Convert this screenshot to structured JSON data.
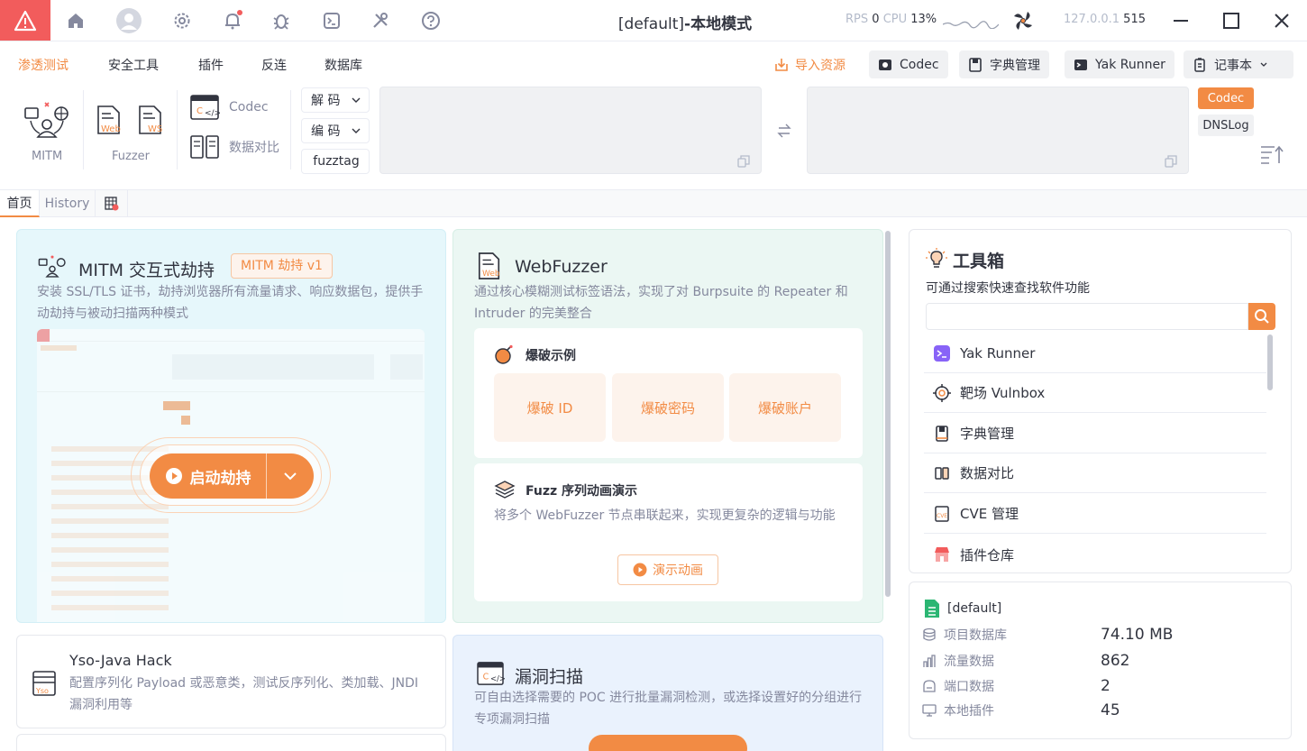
{
  "titlebar": {
    "title_prefix": "[default]",
    "title_suffix": "-本地模式",
    "rps_label": "RPS",
    "rps_value": "0",
    "cpu_label": "CPU",
    "cpu_value": "13%",
    "host": "127.0.0.1",
    "port": "515"
  },
  "menu": {
    "items": [
      "渗透测试",
      "安全工具",
      "插件",
      "反连",
      "数据库"
    ],
    "import_label": "导入资源",
    "buttons": [
      "Codec",
      "字典管理",
      "Yak Runner",
      "记事本"
    ]
  },
  "ribbon": {
    "mitm_label": "MITM",
    "fuzzer_label": "Fuzzer",
    "web_label": "Web",
    "ws_label": "WS",
    "codec_label": "Codec",
    "compare_label": "数据对比",
    "decode_label": "解 码",
    "encode_label": "编 码",
    "fuzztag_label": "fuzztag",
    "codec_tag": "Codec",
    "dnslog_tag": "DNSLog"
  },
  "tabs": [
    "首页",
    "History"
  ],
  "mitm_card": {
    "title": "MITM 交互式劫持",
    "badge": "MITM 劫持 v1",
    "desc": "安装 SSL/TLS 证书，劫持浏览器所有流量请求、响应数据包，提供手动劫持与被动扫描两种模式",
    "start_label": "启动劫持"
  },
  "webfuzzer_card": {
    "title": "WebFuzzer",
    "desc": "通过核心模糊测试标签语法，实现了对 Burpsuite 的 Repeater 和 Intruder 的完美整合",
    "burst_title": "爆破示例",
    "burst_items": [
      "爆破 ID",
      "爆破密码",
      "爆破账户"
    ],
    "seq_title": "Fuzz 序列动画演示",
    "seq_desc": "将多个 WebFuzzer 节点串联起来，实现更复杂的逻辑与功能",
    "demo_label": "演示动画"
  },
  "yso_card": {
    "title": "Yso-Java Hack",
    "desc": "配置序列化 Payload 或恶意类，测试反序列化、类加载、JNDI 漏洞利用等"
  },
  "vuln_card": {
    "title": "漏洞扫描",
    "desc": "可自由选择需要的 POC 进行批量漏洞检测，或选择设置好的分组进行专项漏洞扫描"
  },
  "toolbox": {
    "title": "工具箱",
    "subtitle": "可通过搜索快速查找软件功能",
    "search_placeholder": "",
    "items": [
      "Yak Runner",
      "靶场 Vulnbox",
      "字典管理",
      "数据对比",
      "CVE 管理",
      "插件仓库"
    ]
  },
  "project": {
    "name": "[default]",
    "stats": [
      {
        "label": "项目数据库",
        "value": "74.10 MB"
      },
      {
        "label": "流量数据",
        "value": "862"
      },
      {
        "label": "端口数据",
        "value": "2"
      },
      {
        "label": "本地插件",
        "value": "45"
      }
    ]
  },
  "colors": {
    "accent": "#f28b44",
    "logo_bg": "#f25c5c",
    "mitm_bg": "#e6f7fb",
    "webfuzzer_bg": "#ebf7f3",
    "vuln_bg": "#eaf2fd"
  }
}
